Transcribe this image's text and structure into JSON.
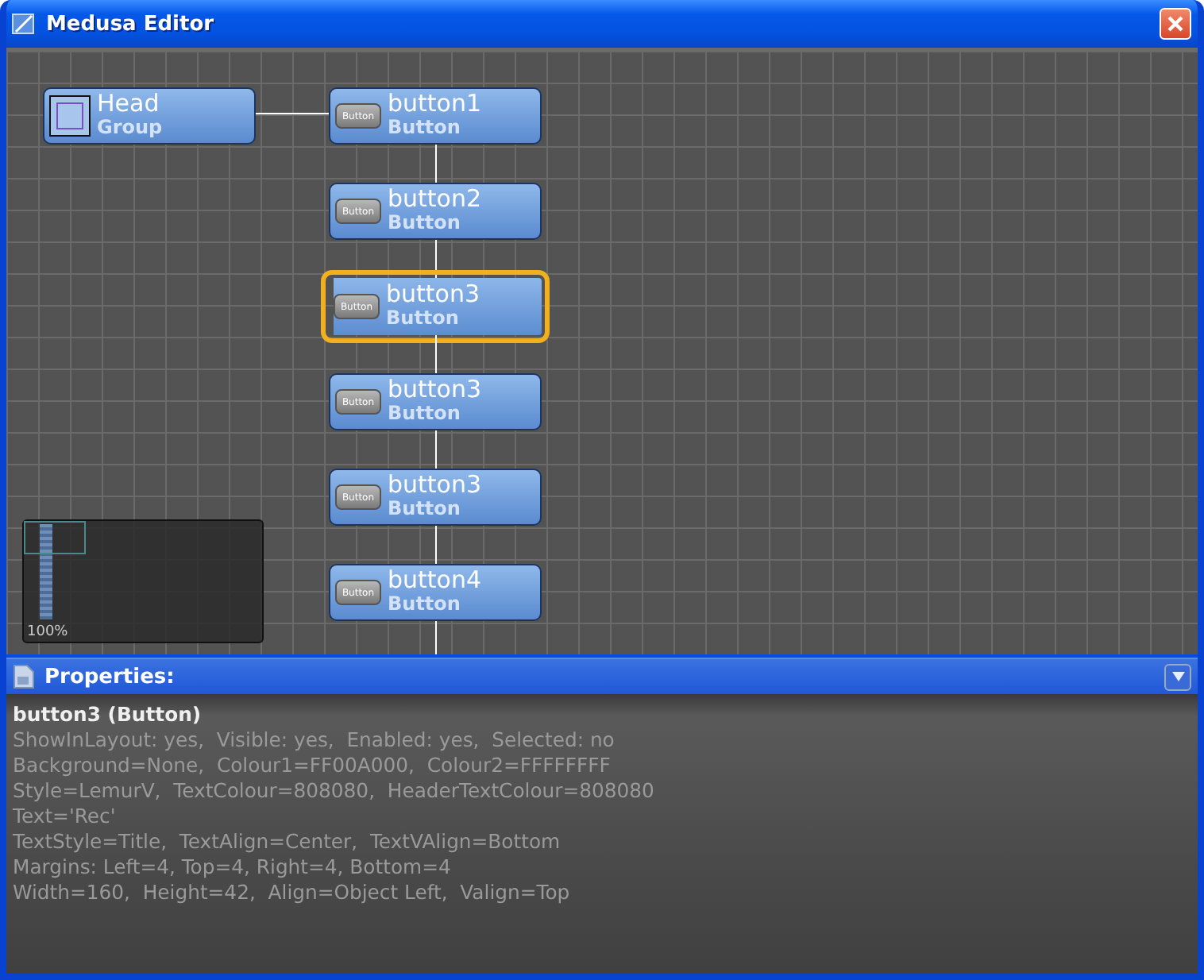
{
  "window": {
    "title": "Medusa Editor"
  },
  "canvas": {
    "root": {
      "kind": "group",
      "title": "Head",
      "type": "Group",
      "selected": false,
      "children": [
        {
          "kind": "button",
          "icon_label": "Button",
          "title": "button1",
          "type": "Button",
          "selected": false
        },
        {
          "kind": "button",
          "icon_label": "Button",
          "title": "button2",
          "type": "Button",
          "selected": false
        },
        {
          "kind": "button",
          "icon_label": "Button",
          "title": "button3",
          "type": "Button",
          "selected": true
        },
        {
          "kind": "button",
          "icon_label": "Button",
          "title": "button3",
          "type": "Button",
          "selected": false
        },
        {
          "kind": "button",
          "icon_label": "Button",
          "title": "button3",
          "type": "Button",
          "selected": false
        },
        {
          "kind": "button",
          "icon_label": "Button",
          "title": "button4",
          "type": "Button",
          "selected": false
        }
      ]
    },
    "minimap": {
      "zoom": "100%"
    }
  },
  "properties": {
    "title": "Properties:",
    "heading": "button3 (Button)",
    "lines": [
      "ShowInLayout: yes,  Visible: yes,  Enabled: yes,  Selected: no",
      "Background=None,  Colour1=FF00A000,  Colour2=FFFFFFFF",
      "Style=LemurV,  TextColour=808080,  HeaderTextColour=808080",
      "Text='Rec'",
      "TextStyle=Title,  TextAlign=Center,  TextVAlign=Bottom",
      "Margins: Left=4, Top=4, Right=4, Bottom=4",
      "Width=160,  Height=42,  Align=Object Left,  Valign=Top"
    ]
  }
}
